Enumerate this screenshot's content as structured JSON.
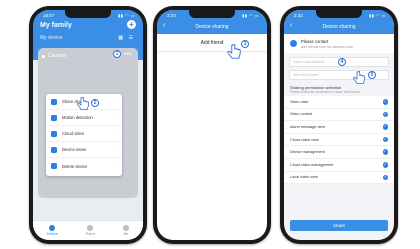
{
  "phone1": {
    "status_time": "18:47",
    "header_title": "My family",
    "add_button": "+",
    "subtitle": "My device",
    "grid_icons": "▦ ☰",
    "camera_label": "Camera",
    "more_icon": "•••",
    "step1": "1",
    "step2": "2",
    "menu": [
      {
        "label": "Share device",
        "icon": "share-icon"
      },
      {
        "label": "Motion detection",
        "icon": "motion-icon"
      },
      {
        "label": "Cloud video",
        "icon": "cloud-icon"
      },
      {
        "label": "Device name",
        "icon": "edit-icon"
      },
      {
        "label": "Delete device",
        "icon": "trash-icon"
      }
    ],
    "chevron": "›",
    "tabs": [
      {
        "label": "Device",
        "active": true
      },
      {
        "label": "Event",
        "active": false
      },
      {
        "label": "Me",
        "active": false
      }
    ]
  },
  "phone2": {
    "status_time": "2:33",
    "back": "‹",
    "title": "Device sharing",
    "add_friend": "Add friend",
    "step3": "3"
  },
  "phone3": {
    "status_time": "2:33",
    "back": "‹",
    "title": "Device sharing",
    "contact_title": "Please contact",
    "contact_sub": "Add friends from the address book",
    "input1_placeholder": "Input email address",
    "input2_placeholder": "Set friend Notes",
    "step4": "4",
    "step5": "5",
    "perm_title": "Sharing permission selection",
    "perm_sub": "Please select the permission to share with friends",
    "permissions": [
      "Video view",
      "Video control",
      "Alarm message view",
      "Cloud video view",
      "Device management",
      "Cloud video management",
      "Local video view"
    ],
    "check": "✓",
    "share_button": "Share"
  },
  "colors": {
    "accent": "#3a8ee6",
    "badge": "#2f6fd8"
  }
}
